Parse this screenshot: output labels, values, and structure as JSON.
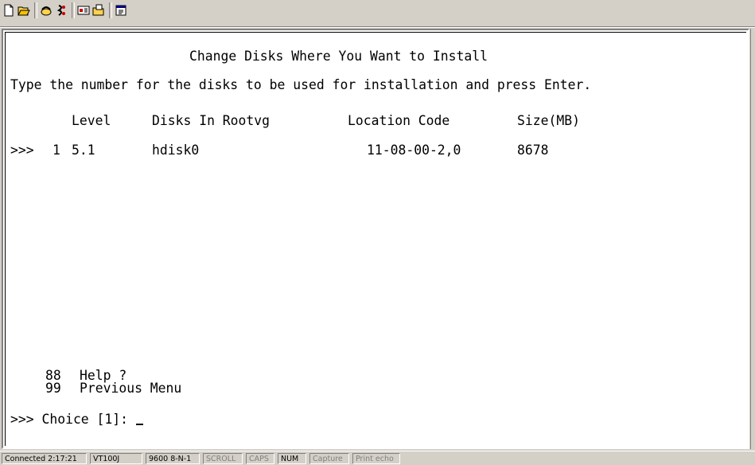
{
  "terminal": {
    "title": "Change Disks Where You Want to Install",
    "instruction": "Type the number for the disks to be used for installation and press Enter.",
    "columns": {
      "level": "Level",
      "disks": "Disks In Rootvg",
      "location": "Location Code",
      "size": "Size(MB)"
    },
    "rows": [
      {
        "marker": ">>>",
        "number": "1",
        "level": "5.1",
        "disk": "hdisk0",
        "location": "11-08-00-2,0",
        "size": "8678"
      }
    ],
    "options": [
      {
        "number": "88",
        "label": "Help ?"
      },
      {
        "number": "99",
        "label": "Previous Menu"
      }
    ],
    "prompt": ">>> Choice [1]: "
  },
  "statusbar": {
    "connected": "Connected 2:17:21",
    "emulation": "VT100J",
    "port": "9600 8-N-1",
    "scroll": "SCROLL",
    "caps": "CAPS",
    "num": "NUM",
    "capture": "Capture",
    "print_echo": "Print echo"
  },
  "toolbar": {
    "icons": [
      "new-icon",
      "open-icon",
      "connect-icon",
      "disconnect-icon",
      "send-icon",
      "receive-icon",
      "properties-icon"
    ]
  }
}
